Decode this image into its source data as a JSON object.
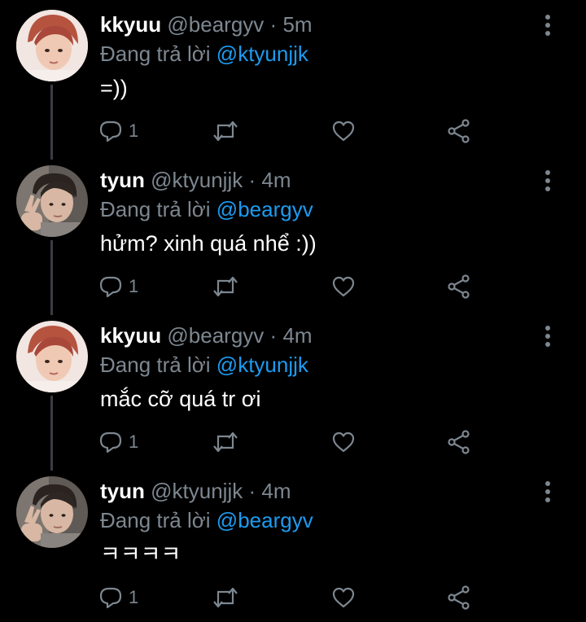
{
  "tweets": [
    {
      "display_name": "kkyuu",
      "handle": "@beargyv",
      "separator": "·",
      "time": "5m",
      "reply_prefix": "Đang trả lời",
      "reply_to": "@ktyunjjk",
      "text": "=))",
      "reply_count": "1",
      "avatar": "kkyuu-avatar"
    },
    {
      "display_name": "tyun",
      "handle": "@ktyunjjk",
      "separator": "·",
      "time": "4m",
      "reply_prefix": "Đang trả lời",
      "reply_to": "@beargyv",
      "text": "hửm? xinh quá nhể :))",
      "reply_count": "1",
      "avatar": "tyun-avatar"
    },
    {
      "display_name": "kkyuu",
      "handle": "@beargyv",
      "separator": "·",
      "time": "4m",
      "reply_prefix": "Đang trả lời",
      "reply_to": "@ktyunjjk",
      "text": "mắc cỡ quá tr ơi",
      "reply_count": "1",
      "avatar": "kkyuu-avatar"
    },
    {
      "display_name": "tyun",
      "handle": "@ktyunjjk",
      "separator": "·",
      "time": "4m",
      "reply_prefix": "Đang trả lời",
      "reply_to": "@beargyv",
      "text": "ㅋㅋㅋㅋ",
      "reply_count": "1",
      "avatar": "tyun-avatar"
    }
  ],
  "icons": {
    "reply": "reply-icon",
    "retweet": "retweet-icon",
    "like": "heart-icon",
    "share": "share-icon",
    "more": "more-vertical-icon"
  },
  "colors": {
    "background": "#000000",
    "text": "#ffffff",
    "muted": "#7d8790",
    "mention": "#1d9bf0",
    "thread_line": "#3a3d42"
  }
}
